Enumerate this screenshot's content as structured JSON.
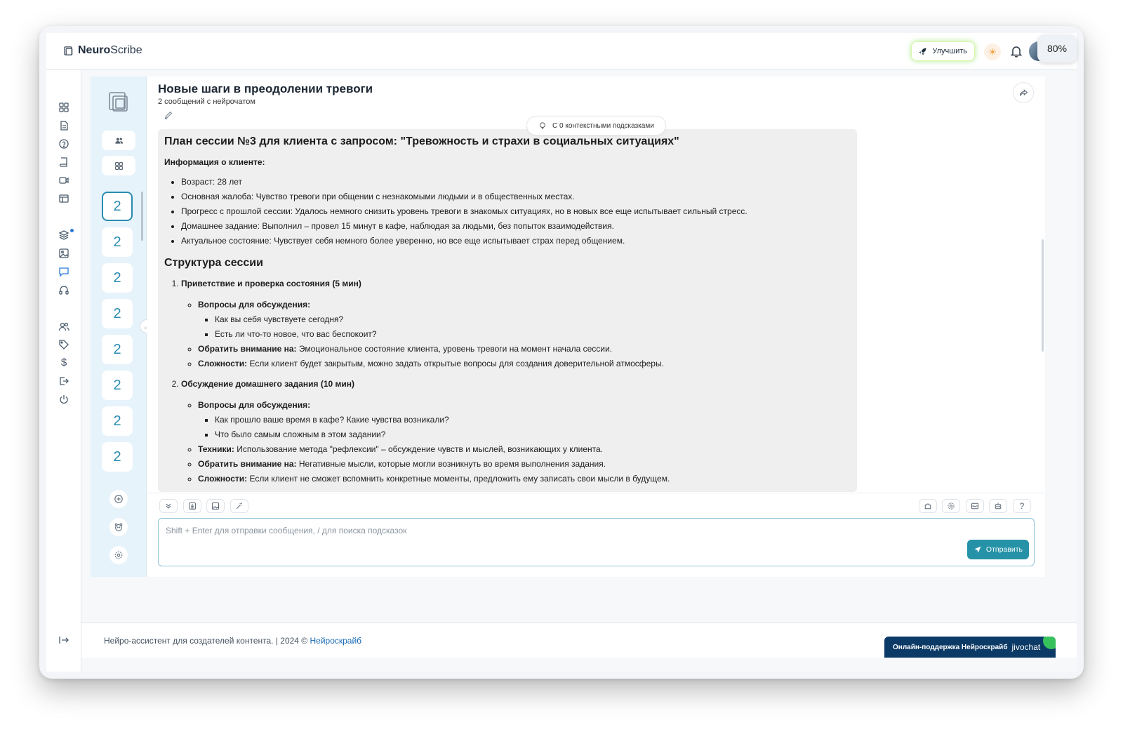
{
  "app": {
    "logo_bold": "Neuro",
    "logo_normal": "Scribe",
    "upgrade_label": "Улучшить",
    "zoom": "80%"
  },
  "chatlist": {
    "items": [
      "2",
      "2",
      "2",
      "2",
      "2",
      "2",
      "2",
      "2"
    ]
  },
  "chat": {
    "title": "Новые шаги в преодолении тревоги",
    "subtitle": "2 сообщений с нейрочатом",
    "context_pill": "С 0 контекстными подсказками"
  },
  "message": {
    "heading": "План сессии №3 для клиента с запросом: \"Тревожность и страхи в социальных ситуациях\"",
    "client_info_label": "Информация о клиенте:",
    "client_info": [
      "Возраст: 28 лет",
      "Основная жалоба: Чувство тревоги при общении с незнакомыми людьми и в общественных местах.",
      "Прогресс с прошлой сессии: Удалось немного снизить уровень тревоги в знакомых ситуациях, но в новых все еще испытывает сильный стресс.",
      "Домашнее задание: Выполнил – провел 15 минут в кафе, наблюдая за людьми, без попыток взаимодействия.",
      "Актуальное состояние: Чувствует себя немного более уверенно, но все еще испытывает страх перед общением."
    ],
    "structure_heading": "Структура сессии",
    "sections": [
      {
        "title": "Приветствие и проверка состояния (5 мин)",
        "questions_label": "Вопросы для обсуждения:",
        "questions": [
          "Как вы себя чувствуете сегодня?",
          "Есть ли что-то новое, что вас беспокоит?"
        ],
        "attention_label": "Обратить внимание на:",
        "attention": "Эмоциональное состояние клиента, уровень тревоги на момент начала сессии.",
        "difficulty_label": "Сложности:",
        "difficulty": "Если клиент будет закрытым, можно задать открытые вопросы для создания доверительной атмосферы."
      },
      {
        "title": "Обсуждение домашнего задания (10 мин)",
        "questions_label": "Вопросы для обсуждения:",
        "questions": [
          "Как прошло ваше время в кафе? Какие чувства возникали?",
          "Что было самым сложным в этом задании?"
        ],
        "technique_label": "Техники:",
        "technique": "Использование метода \"рефлексии\" – обсуждение чувств и мыслей, возникающих у клиента.",
        "attention_label": "Обратить внимание на:",
        "attention": "Негативные мысли, которые могли возникнуть во время выполнения задания.",
        "difficulty_label": "Сложности:",
        "difficulty": "Если клиент не сможет вспомнить конкретные моменты, предложить ему записать свои мысли в будущем."
      }
    ]
  },
  "composer": {
    "placeholder": "Shift + Enter для отправки сообщения, / для поиска подсказок",
    "send_label": "Отправить"
  },
  "footer": {
    "text": "Нейро-ассистент для создателей контента.  | 2024 © ",
    "link": "Нейроскрайб"
  },
  "support": {
    "label": "Онлайн-поддержка Нейроскрайб",
    "brand": "jivochat"
  }
}
